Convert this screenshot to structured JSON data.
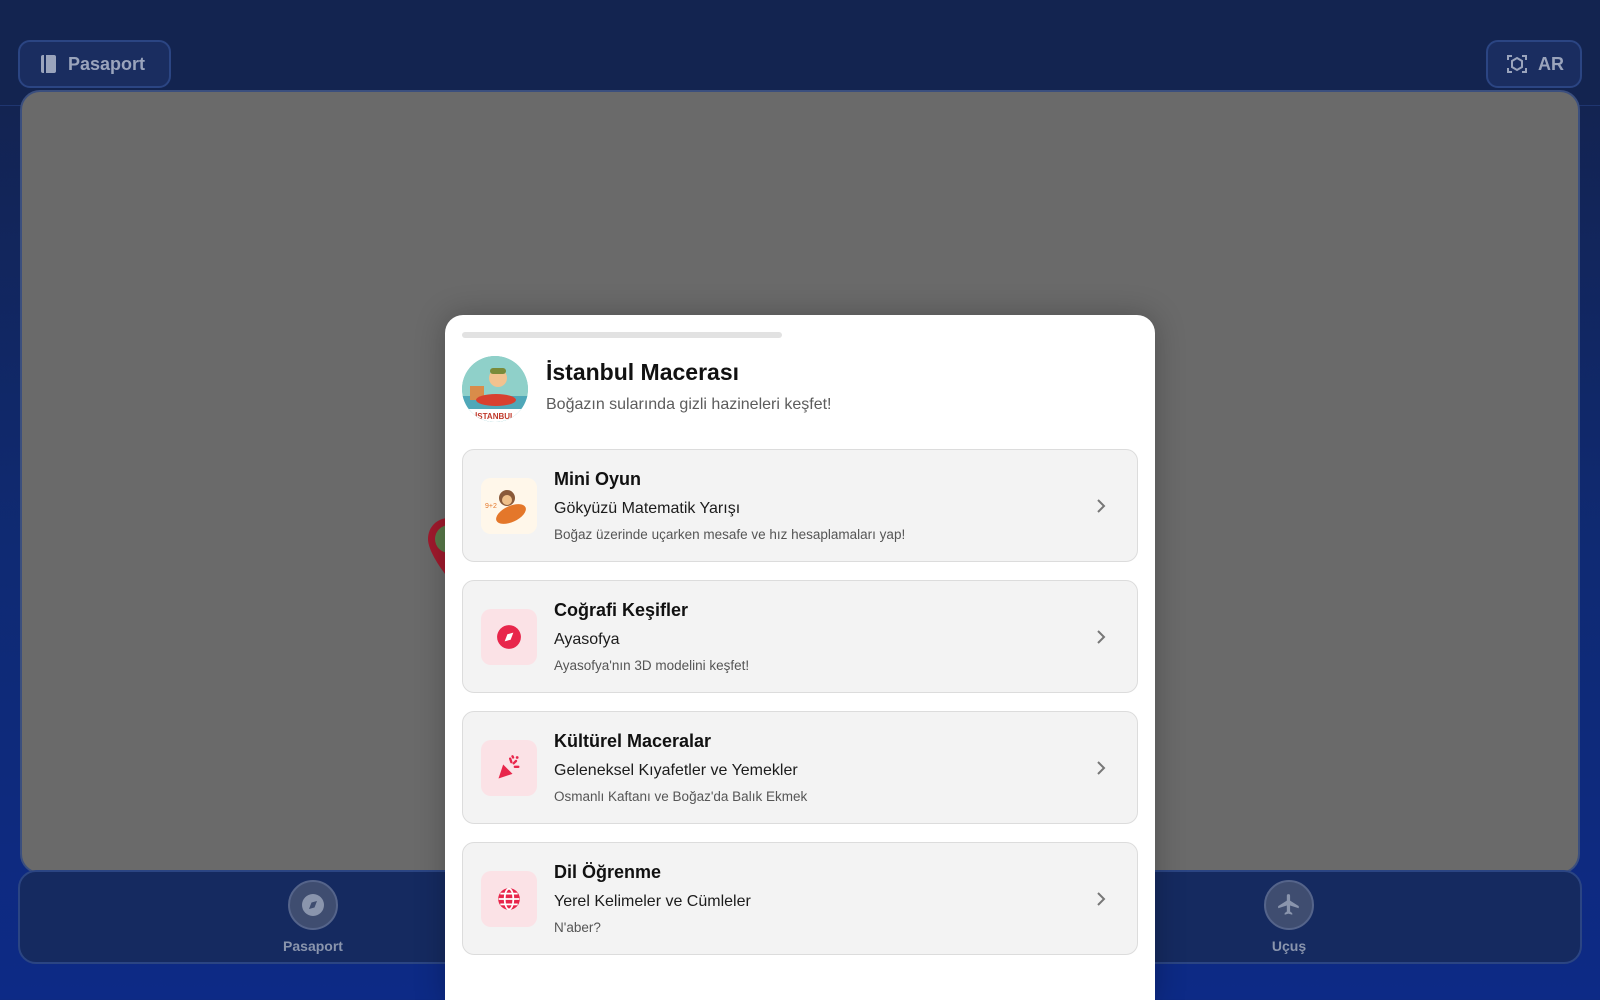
{
  "topbar": {
    "passport_label": "Pasaport",
    "ar_label": "AR"
  },
  "bottom_nav": {
    "left_label": "Pasaport",
    "right_label": "Uçuş"
  },
  "sheet": {
    "title": "İstanbul Macerası",
    "subtitle": "Boğazın sularında gizli hazineleri keşfet!",
    "badge_text": "İSTANBUL",
    "cards": [
      {
        "category": "Mini Oyun",
        "name": "Gökyüzü Matematik Yarışı",
        "desc": "Boğaz üzerinde uçarken mesafe ve hız hesaplamaları yap!",
        "icon": "kid-rocket-illustration",
        "photo_text": "9+2"
      },
      {
        "category": "Coğrafi Keşifler",
        "name": "Ayasofya",
        "desc": "Ayasofya'nın 3D modelini keşfet!",
        "icon": "compass-icon"
      },
      {
        "category": "Kültürel Maceralar",
        "name": "Geleneksel Kıyafetler ve Yemekler",
        "desc": "Osmanlı Kaftanı ve Boğaz'da Balık Ekmek",
        "icon": "party-popper-icon"
      },
      {
        "category": "Dil Öğrenme",
        "name": "Yerel Kelimeler ve Cümleler",
        "desc": "N'aber?",
        "icon": "globe-icon"
      }
    ]
  },
  "colors": {
    "accent": "#e8264b",
    "background": "#13234f",
    "overlay": "#6a6a6a"
  }
}
